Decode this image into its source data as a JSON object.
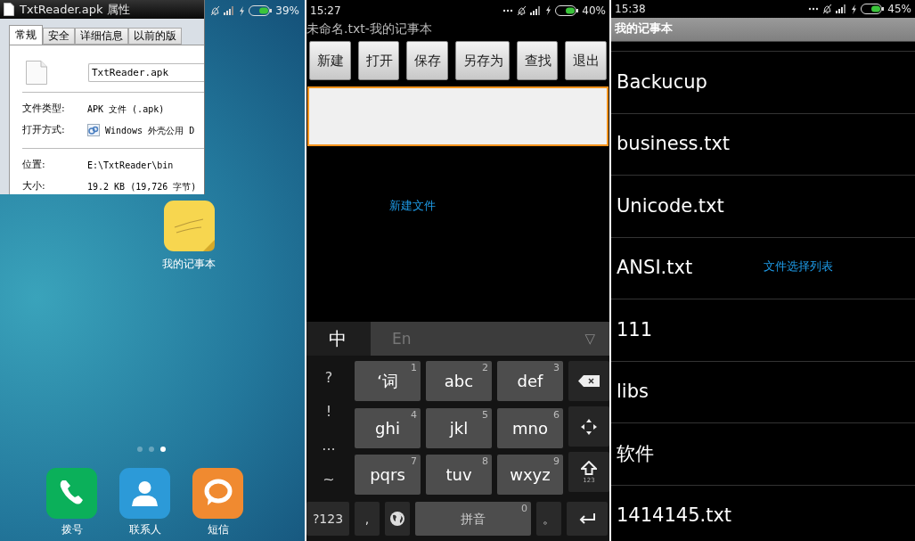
{
  "home_screen": {
    "status_bar": {
      "battery": "39%"
    },
    "properties_dialog": {
      "title": "TxtReader.apk 属性",
      "tabs": [
        {
          "label": "常规",
          "selected": true
        },
        {
          "label": "安全",
          "selected": false
        },
        {
          "label": "详细信息",
          "selected": false
        },
        {
          "label": "以前的版",
          "selected": false
        }
      ],
      "file_name": "TxtReader.apk",
      "groups": [
        [
          {
            "label": "文件类型:",
            "value": "APK 文件 (.apk)",
            "kind": "text"
          },
          {
            "label": "打开方式:",
            "value": "Windows 外壳公用 D",
            "kind": "program"
          }
        ],
        [
          {
            "label": "位置:",
            "value": "E:\\TxtReader\\bin",
            "kind": "text"
          },
          {
            "label": "大小:",
            "value": "19.2 KB (19,726 字节)",
            "kind": "text"
          }
        ]
      ]
    },
    "apps": [
      {
        "label": "我的记事本"
      }
    ],
    "page_dots": [
      {
        "selected": false
      },
      {
        "selected": false
      },
      {
        "selected": true
      }
    ],
    "dock": [
      {
        "label": "拨号",
        "kind": "phone"
      },
      {
        "label": "联系人",
        "kind": "contacts"
      },
      {
        "label": "短信",
        "kind": "messages"
      }
    ]
  },
  "editor_screen": {
    "status_bar": {
      "time": "15:27",
      "battery": "40%"
    },
    "title": "未命名.txt-我的记事本",
    "toolbar": [
      "新建",
      "打开",
      "保存",
      "另存为",
      "查找",
      "退出"
    ],
    "text_area": {
      "focused": true
    },
    "annotation": "新建文件",
    "keyboard": {
      "modes": [
        {
          "label": "中",
          "selected": true
        },
        {
          "label": "En",
          "selected": false
        }
      ],
      "menu": "▽",
      "side_symbols": [
        "?",
        "!",
        "...",
        "~"
      ],
      "keys": [
        {
          "label": "‘词",
          "digit": "1"
        },
        {
          "label": "abc",
          "digit": "2"
        },
        {
          "label": "def",
          "digit": "3"
        },
        {
          "label": "ghi",
          "digit": "4"
        },
        {
          "label": "jkl",
          "digit": "5"
        },
        {
          "label": "mno",
          "digit": "6"
        },
        {
          "label": "pqrs",
          "digit": "7"
        },
        {
          "label": "tuv",
          "digit": "8"
        },
        {
          "label": "wxyz",
          "digit": "9"
        }
      ],
      "right_keys": [
        {
          "kind": "backspace"
        },
        {
          "kind": "move"
        },
        {
          "kind": "shift",
          "label": "123"
        }
      ],
      "bottom_row": [
        {
          "kind": "text",
          "label": "?123"
        },
        {
          "kind": "text",
          "label": ","
        },
        {
          "kind": "globe"
        },
        {
          "kind": "space",
          "label": "拼音",
          "digit": "0"
        },
        {
          "kind": "text",
          "label": "。"
        },
        {
          "kind": "enter"
        }
      ]
    }
  },
  "file_list_screen": {
    "status_bar": {
      "time": "15:38",
      "battery": "45%"
    },
    "title": "我的记事本",
    "files": [
      "Backucup",
      "business.txt",
      "Unicode.txt",
      "ANSI.txt",
      "111",
      "libs",
      "软件",
      "1414145.txt"
    ],
    "annotation": "文件选择列表"
  }
}
